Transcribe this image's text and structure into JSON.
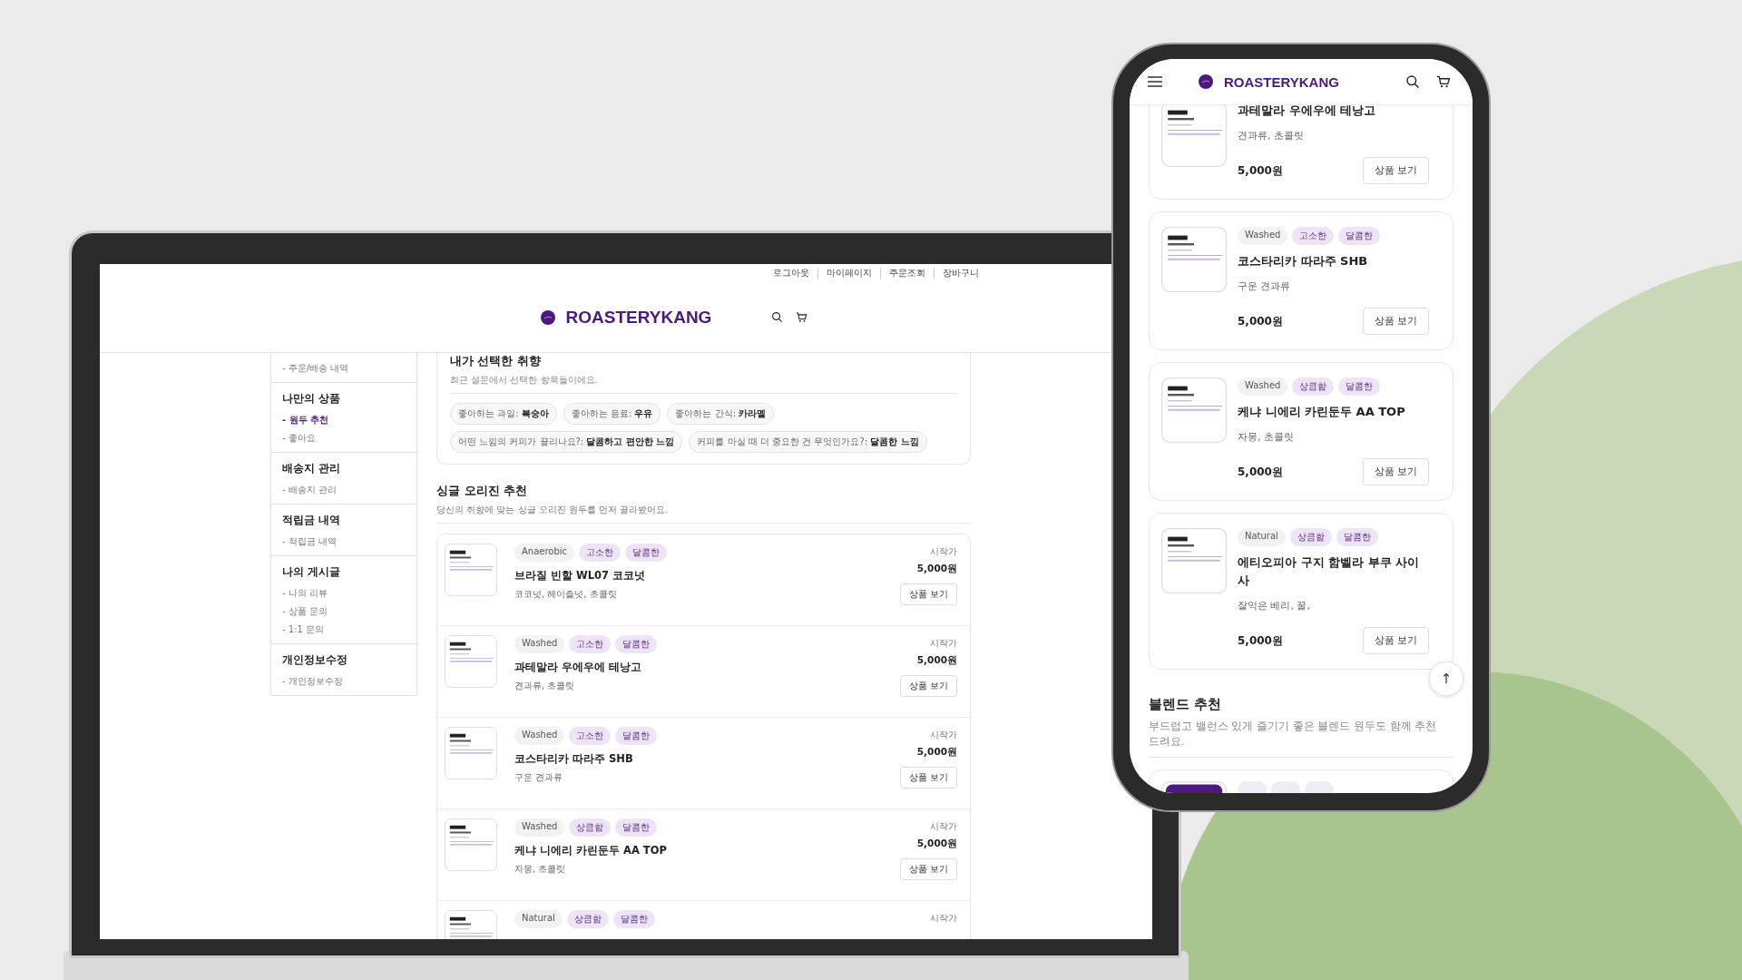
{
  "laptop": {
    "util_links": [
      {
        "label": "로그아웃"
      },
      {
        "label": "마이페이지"
      },
      {
        "label": "주문조회"
      },
      {
        "label": "장바구니"
      }
    ],
    "brand": "ROASTERYKANG",
    "sidebar": [
      {
        "items": [
          {
            "label": "- 주문/배송 내역",
            "selected": false
          }
        ]
      },
      {
        "title": "나만의 상품",
        "items": [
          {
            "label": "- 원두 추천",
            "selected": true
          },
          {
            "label": "- 좋아요",
            "selected": false
          }
        ]
      },
      {
        "title": "배송지 관리",
        "items": [
          {
            "label": "- 배송지 관리",
            "selected": false
          }
        ]
      },
      {
        "title": "적립금 내역",
        "items": [
          {
            "label": "- 적립금 내역",
            "selected": false
          }
        ]
      },
      {
        "title": "나의 게시글",
        "items": [
          {
            "label": "- 나의 리뷰",
            "selected": false
          },
          {
            "label": "- 상품 문의",
            "selected": false
          },
          {
            "label": "- 1:1 문의",
            "selected": false
          }
        ]
      },
      {
        "title": "개인정보수정",
        "items": [
          {
            "label": "- 개인정보수정",
            "selected": false
          }
        ]
      }
    ],
    "preferences": {
      "title": "내가 선택한 취향",
      "subtitle": "최근 설문에서 선택한 항목들이에요.",
      "chips": [
        "좋아하는 과일: **복숭아**",
        "좋아하는 음료: **우유**",
        "좋아하는 간식: **카라멜**",
        "어떤 느낌의 커피가 끌리나요?: **달콤하고 편안한 느낌**",
        "커피를 마실 때 더 중요한 건 무엇인가요?: **달콤한 느낌**"
      ]
    },
    "section": {
      "title": "싱글 오리진 추천",
      "subtitle": "당신의 취향에 맞는 싱글 오리진 원두를 먼저 골라봤어요."
    },
    "products": [
      {
        "tags": [
          {
            "label": "Anaerobic",
            "kind": "method"
          },
          {
            "label": "고소한",
            "kind": "flavor"
          },
          {
            "label": "달콤한",
            "kind": "flavor"
          }
        ],
        "name": "브라질 빈할 WL07 코코넛",
        "notes": "코코넛, 헤이즐넛, 초콜릿",
        "price_label": "시작가",
        "price": "5,000원",
        "button": "상품 보기"
      },
      {
        "tags": [
          {
            "label": "Washed",
            "kind": "method"
          },
          {
            "label": "고소한",
            "kind": "flavor"
          },
          {
            "label": "달콤한",
            "kind": "flavor"
          }
        ],
        "name": "과테말라 우에우에 테낭고",
        "notes": "견과류, 초콜릿",
        "price_label": "시작가",
        "price": "5,000원",
        "button": "상품 보기"
      },
      {
        "tags": [
          {
            "label": "Washed",
            "kind": "method"
          },
          {
            "label": "고소한",
            "kind": "flavor"
          },
          {
            "label": "달콤한",
            "kind": "flavor"
          }
        ],
        "name": "코스타리카 따라주 SHB",
        "notes": "구운 견과류",
        "price_label": "시작가",
        "price": "5,000원",
        "button": "상품 보기"
      },
      {
        "tags": [
          {
            "label": "Washed",
            "kind": "method"
          },
          {
            "label": "상큼함",
            "kind": "flavor"
          },
          {
            "label": "달콤한",
            "kind": "flavor"
          }
        ],
        "name": "케냐 니에리 카린둔두 AA TOP",
        "notes": "자몽, 초콜릿",
        "price_label": "시작가",
        "price": "5,000원",
        "button": "상품 보기"
      },
      {
        "tags": [
          {
            "label": "Natural",
            "kind": "method"
          },
          {
            "label": "상큼함",
            "kind": "flavor"
          },
          {
            "label": "달콤한",
            "kind": "flavor"
          }
        ],
        "price_label": "시작가"
      }
    ]
  },
  "phone": {
    "brand": "ROASTERYKANG",
    "products": [
      {
        "name": "과테말라 우에우에 테낭고",
        "notes": "견과류, 초콜릿",
        "price": "5,000원",
        "button": "상품 보기"
      },
      {
        "tags": [
          {
            "label": "Washed",
            "kind": "method"
          },
          {
            "label": "고소한",
            "kind": "flavor"
          },
          {
            "label": "달콤한",
            "kind": "flavor"
          }
        ],
        "name": "코스타리카 따라주 SHB",
        "notes": "구운 견과류",
        "price": "5,000원",
        "button": "상품 보기"
      },
      {
        "tags": [
          {
            "label": "Washed",
            "kind": "method"
          },
          {
            "label": "상큼함",
            "kind": "flavor"
          },
          {
            "label": "달콤한",
            "kind": "flavor"
          }
        ],
        "name": "케냐 니에리 카린둔두 AA TOP",
        "notes": "자몽, 초콜릿",
        "price": "5,000원",
        "button": "상품 보기"
      },
      {
        "tags": [
          {
            "label": "Natural",
            "kind": "method"
          },
          {
            "label": "상큼함",
            "kind": "flavor"
          },
          {
            "label": "달콤한",
            "kind": "flavor"
          }
        ],
        "name": "에티오피아 구지 함벨라 부쿠 사이사",
        "notes": "잘익은 베리, 꿀,",
        "price": "5,000원",
        "button": "상품 보기"
      }
    ],
    "scroll_top_button": "↑",
    "section": {
      "title": "블렌드 추천",
      "subtitle": "부드럽고 밸런스 있게 즐기기 좋은 블렌드 원두도 함께 추천드려요."
    }
  }
}
